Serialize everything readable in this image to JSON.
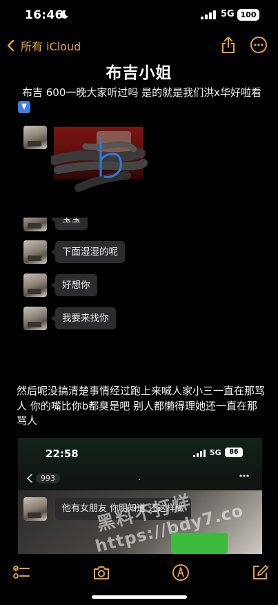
{
  "status_bar": {
    "time": "16:46",
    "network": "5G",
    "battery": "100"
  },
  "nav": {
    "back_label": "所有 iCloud"
  },
  "note": {
    "title": "布吉小姐",
    "paragraph_1": "布吉 600一晚大家听过吗 是的就是我们洪x华好啦看",
    "paragraph_2": "然后呢没搞清楚事情经过跑上来喊人家小三一直在那骂人 你的嘴比你b都臭是吧 别人都懒得理她还一直在那骂人"
  },
  "chat": {
    "cut_message": "宝宝",
    "messages": [
      "下面湿湿的呢",
      "好想你",
      "我要来找你"
    ]
  },
  "screenshot": {
    "time": "22:58",
    "network": "5G",
    "battery": "86",
    "back_count": "993",
    "title_dot": ".",
    "message": "他有女朋友 你明知道 还这样做"
  },
  "watermark": {
    "line_1": "黑料不打烊",
    "line_2": "https://bdy7.co"
  },
  "colors": {
    "accent": "#e6a23a",
    "background": "#000000",
    "bubble": "#2c2c2e"
  },
  "icons": [
    "moon-icon",
    "signal-icon",
    "chevron-left-icon",
    "share-icon",
    "more-icon",
    "down-arrow-emoji",
    "checklist-icon",
    "camera-icon",
    "markup-icon",
    "compose-icon"
  ]
}
